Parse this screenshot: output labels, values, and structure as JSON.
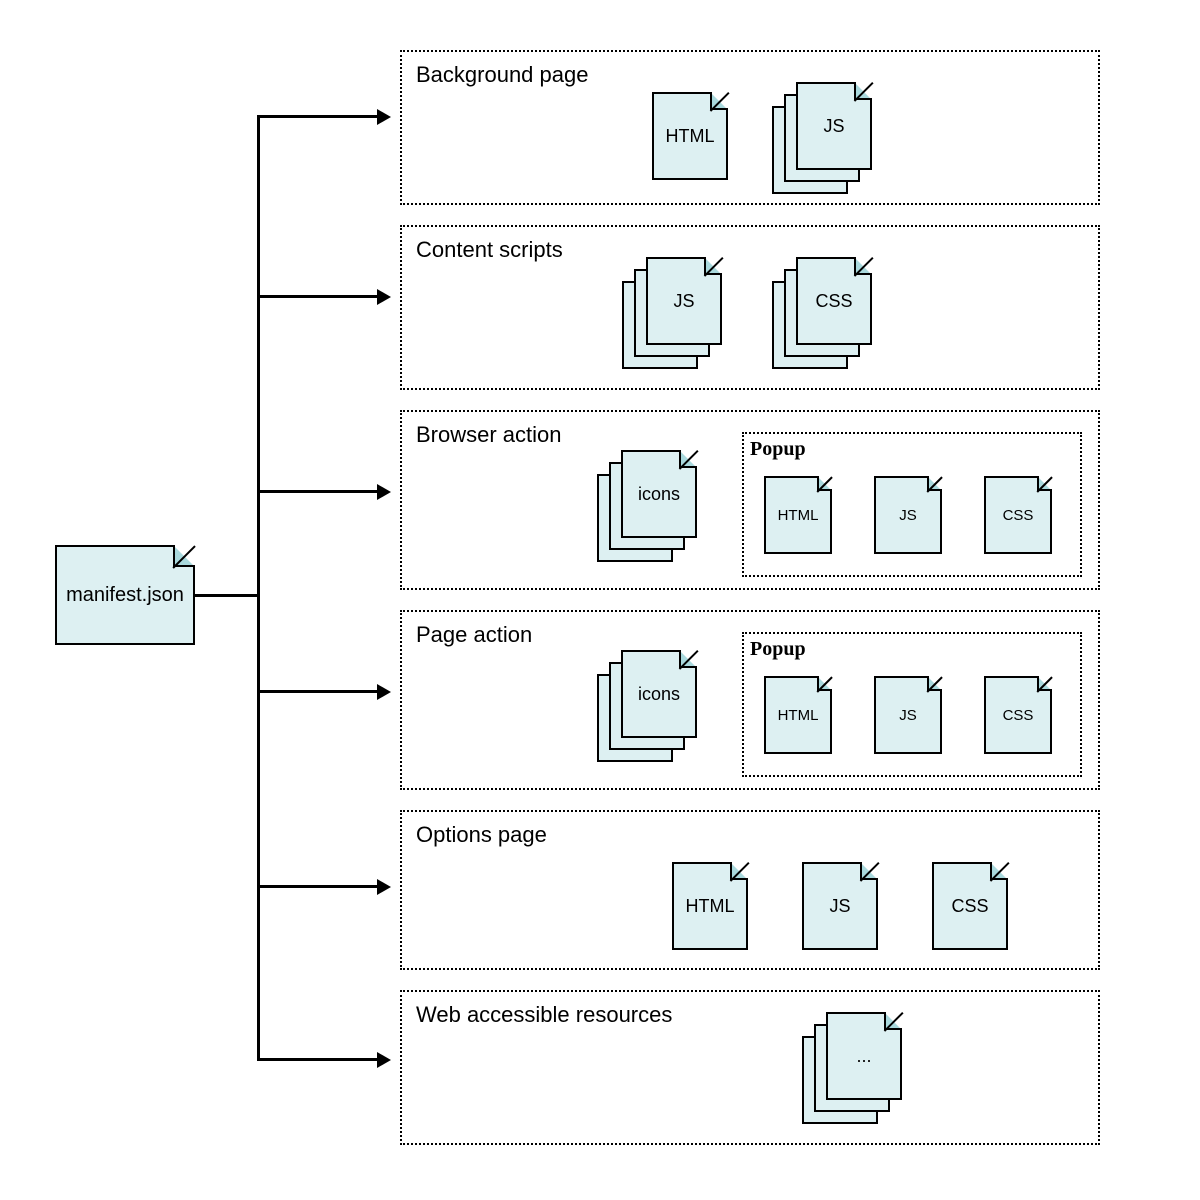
{
  "root": {
    "label": "manifest.json"
  },
  "sections": [
    {
      "title": "Background page",
      "files": [
        "HTML",
        "JS"
      ],
      "popup": null
    },
    {
      "title": "Content scripts",
      "files": [
        "JS",
        "CSS"
      ],
      "popup": null
    },
    {
      "title": "Browser action",
      "files": [
        "icons"
      ],
      "popup": {
        "title": "Popup",
        "files": [
          "HTML",
          "JS",
          "CSS"
        ]
      }
    },
    {
      "title": "Page action",
      "files": [
        "icons"
      ],
      "popup": {
        "title": "Popup",
        "files": [
          "HTML",
          "JS",
          "CSS"
        ]
      }
    },
    {
      "title": "Options page",
      "files": [
        "HTML",
        "JS",
        "CSS"
      ],
      "popup": null
    },
    {
      "title": "Web accessible resources",
      "files": [
        "..."
      ],
      "popup": null
    }
  ],
  "colors": {
    "fileFill": "#ddf0f2",
    "border": "#000000"
  }
}
